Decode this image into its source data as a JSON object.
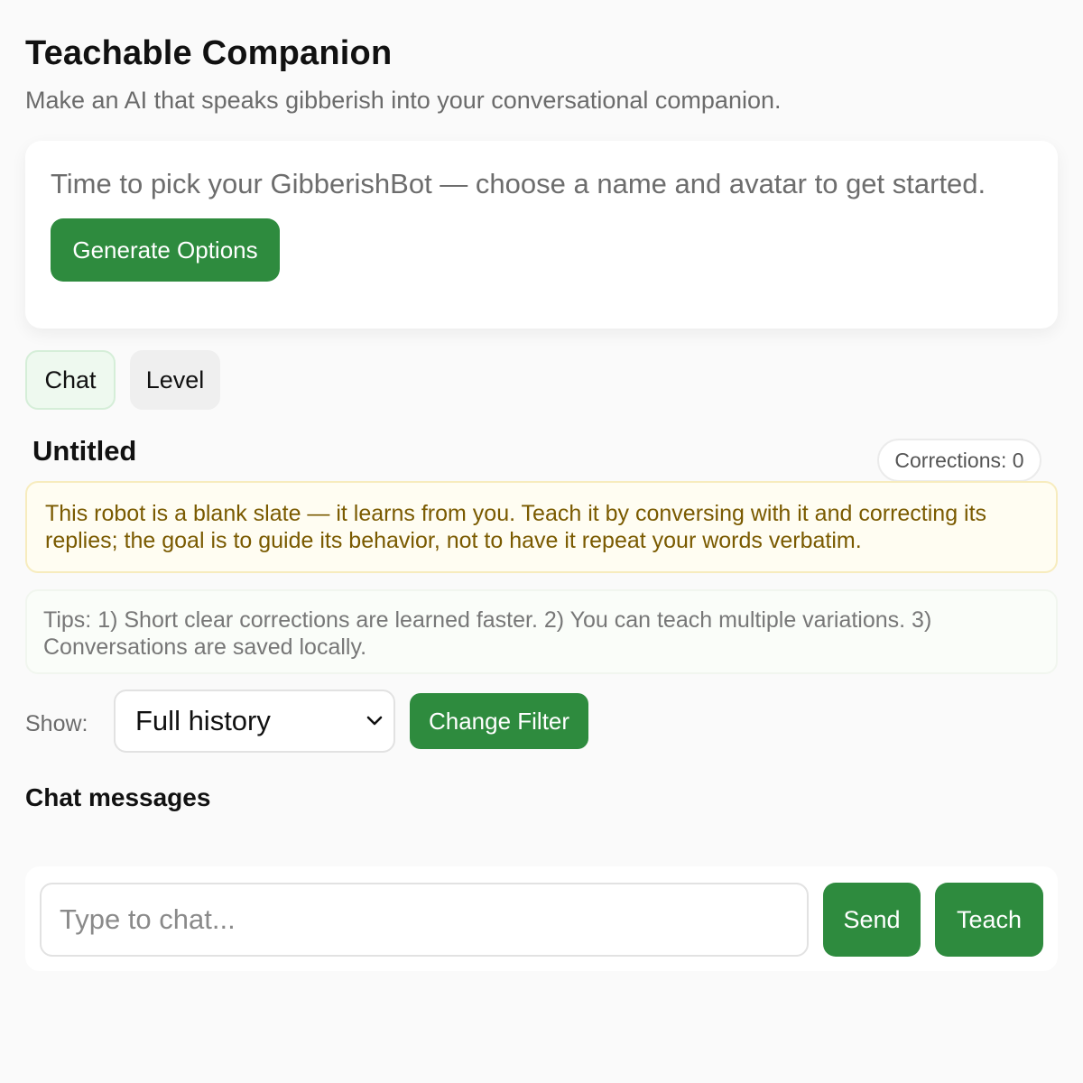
{
  "header": {
    "title": "Teachable Companion",
    "subtitle": "Make an AI that speaks gibberish into your conversational companion."
  },
  "setup": {
    "prompt": "Time to pick your GibberishBot — choose a name and avatar to get started.",
    "generate_label": "Generate Options"
  },
  "tabs": [
    {
      "label": "Chat",
      "active": true
    },
    {
      "label": "Level",
      "active": false
    }
  ],
  "bot": {
    "name": "Untitled",
    "corrections_label": "Corrections: 0"
  },
  "notice": "This robot is a blank slate — it learns from you. Teach it by conversing with it and correcting its replies; the goal is to guide its behavior, not to have it repeat your words verbatim.",
  "tips": "Tips: 1) Short clear corrections are learned faster. 2) You can teach multiple variations. 3) Conversations are saved locally.",
  "filter": {
    "label": "Show:",
    "selected": "Full history",
    "change_label": "Change Filter"
  },
  "messages": {
    "heading": "Chat messages"
  },
  "composer": {
    "placeholder": "Type to chat...",
    "send_label": "Send",
    "teach_label": "Teach"
  },
  "colors": {
    "accent": "#2e8b3e",
    "notice_text": "#7a5a00",
    "notice_bg": "#fffdf2"
  },
  "icons": [
    "chevron-down-icon"
  ]
}
